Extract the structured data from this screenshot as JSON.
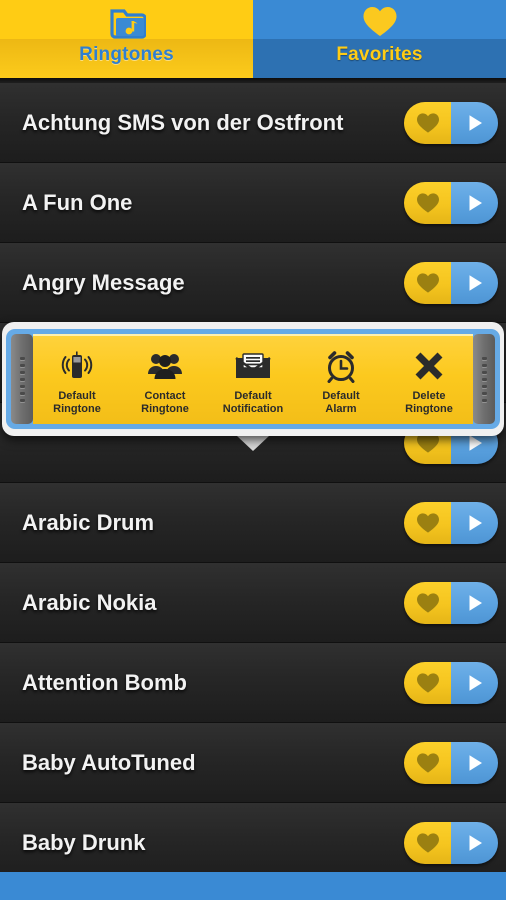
{
  "tabs": [
    {
      "label": "Ringtones",
      "icon": "music-folder-icon",
      "active": true
    },
    {
      "label": "Favorites",
      "icon": "heart-icon",
      "active": false
    }
  ],
  "list": {
    "rows": [
      {
        "title": "Achtung SMS von der Ostfront"
      },
      {
        "title": "A Fun One"
      },
      {
        "title": "Angry Message"
      },
      {
        "title": ""
      },
      {
        "title": ""
      },
      {
        "title": "Arabic Drum"
      },
      {
        "title": "Arabic Nokia"
      },
      {
        "title": "Attention Bomb"
      },
      {
        "title": "Baby AutoTuned"
      },
      {
        "title": "Baby Drunk"
      }
    ],
    "favorite_icon": "heart-icon",
    "play_icon": "play-icon"
  },
  "popup": {
    "items": [
      {
        "line1": "Default",
        "line2": "Ringtone",
        "icon": "vibrating-phone-icon"
      },
      {
        "line1": "Contact",
        "line2": "Ringtone",
        "icon": "contacts-group-icon"
      },
      {
        "line1": "Default",
        "line2": "Notification",
        "icon": "envelope-icon"
      },
      {
        "line1": "Default",
        "line2": "Alarm",
        "icon": "alarm-clock-icon"
      },
      {
        "line1": "Delete",
        "line2": "Ringtone",
        "icon": "close-x-icon"
      }
    ]
  },
  "colors": {
    "accent_yellow": "#fcc91e",
    "accent_blue": "#3a8ad4",
    "tab_label_ringtones": "#2f7fd0",
    "tab_label_favorites": "#ffcc14",
    "row_text": "#f2f2f2",
    "heart_fill": "#9b8011",
    "popup_border": "#66aae6"
  }
}
